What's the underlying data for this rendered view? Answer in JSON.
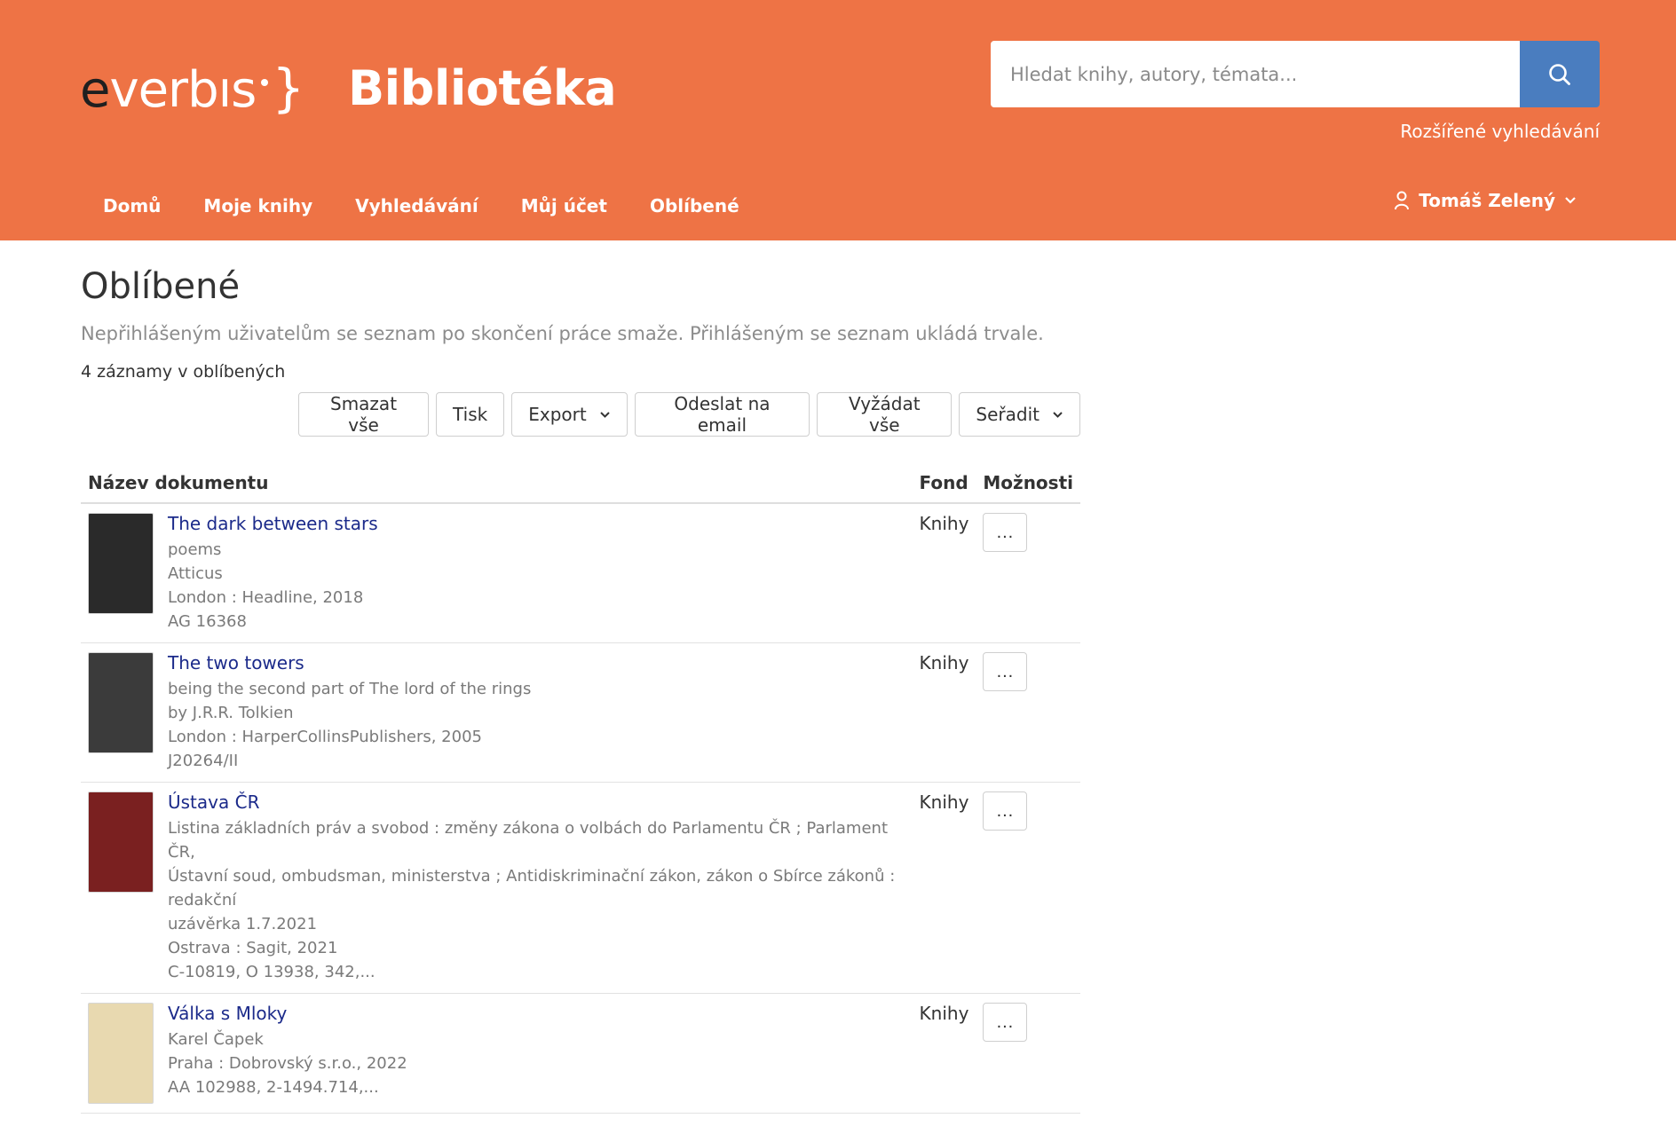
{
  "header": {
    "logo_e": "e",
    "logo_rest": "verbıs",
    "logo_brace": "}",
    "title": "Bibliotéka",
    "search_placeholder": "Hledat knihy, autory, témata...",
    "advanced_search": "Rozšířené vyhledávání",
    "nav": [
      "Domů",
      "Moje knihy",
      "Vyhledávání",
      "Můj účet",
      "Oblíbené"
    ],
    "user": "Tomáš Zelený"
  },
  "page": {
    "title": "Oblíbené",
    "info": "Nepřihlášeným uživatelům se seznam po skončení práce smaže. Přihlášeným se seznam ukládá trvale.",
    "count": "4 záznamy v oblíbených"
  },
  "toolbar": {
    "delete_all": "Smazat vše",
    "print": "Tisk",
    "export": "Export",
    "send_email": "Odeslat na email",
    "request_all": "Vyžádat vše",
    "sort": "Seřadit"
  },
  "table": {
    "headers": [
      "Název dokumentu",
      "Fond",
      "Možnosti"
    ],
    "more_label": "...",
    "rows": [
      {
        "title": "The dark between stars",
        "lines": [
          "poems",
          "Atticus",
          "London : Headline, 2018",
          "AG 16368"
        ],
        "fond": "Knihy",
        "cover_color": "#2a2a2a"
      },
      {
        "title": "The two towers",
        "lines": [
          "being the second part of The lord of the rings",
          "by J.R.R. Tolkien",
          "London : HarperCollinsPublishers, 2005",
          "J20264/II"
        ],
        "fond": "Knihy",
        "cover_color": "#3b3b3b"
      },
      {
        "title": "Ústava ČR",
        "lines": [
          "Listina základních práv a svobod : změny zákona o volbách do Parlamentu ČR ; Parlament ČR,",
          "Ústavní soud, ombudsman, ministerstva ; Antidiskriminační zákon, zákon o Sbírce zákonů : redakční",
          "uzávěrka 1.7.2021",
          "Ostrava : Sagit, 2021",
          "C-10819, O 13938, 342,..."
        ],
        "fond": "Knihy",
        "cover_color": "#7a2020"
      },
      {
        "title": "Válka s Mloky",
        "lines": [
          "Karel Čapek",
          "Praha : Dobrovský s.r.o., 2022",
          "AA 102988, 2-1494.714,..."
        ],
        "fond": "Knihy",
        "cover_color": "#e8d9b0"
      }
    ]
  },
  "colors": {
    "header_bg": "#ee7345",
    "search_button": "#4a7dbf",
    "link": "#1b2a8a"
  },
  "icons": {
    "search": "search-icon",
    "user": "user-icon",
    "chevron": "chevron-down-icon"
  }
}
